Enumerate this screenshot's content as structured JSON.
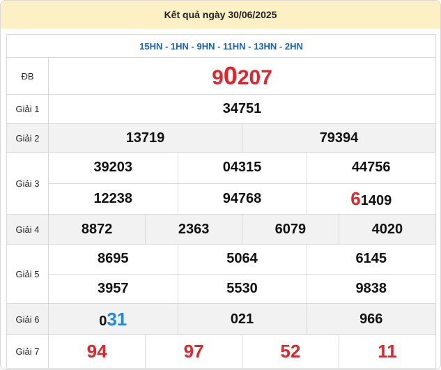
{
  "header": {
    "title": "Kết quả ngày 30/06/2025"
  },
  "codes": "15HN - 1HN - 9HN - 11HN - 13HN - 2HN",
  "db": {
    "label": "ĐB",
    "prefix": "9",
    "highlight": "0",
    "rest": "207"
  },
  "g1": {
    "label": "Giải 1",
    "values": [
      "34751"
    ]
  },
  "g2": {
    "label": "Giải 2",
    "values": [
      "13719",
      "79394"
    ]
  },
  "g3": {
    "label": "Giải 3",
    "values": [
      "39203",
      "04315",
      "44756",
      "12238",
      "94768"
    ],
    "last": {
      "highlight": "6",
      "rest": "1409"
    }
  },
  "g4": {
    "label": "Giải 4",
    "values": [
      "8872",
      "2363",
      "6079",
      "4020"
    ]
  },
  "g5": {
    "label": "Giải 5",
    "values": [
      "8695",
      "5064",
      "6145",
      "3957",
      "5530",
      "9838"
    ]
  },
  "g6": {
    "label": "Giải 6",
    "first": {
      "prefix": "0",
      "highlight": "31"
    },
    "values": [
      "021",
      "966"
    ]
  },
  "g7": {
    "label": "Giải 7",
    "values": [
      "94",
      "97",
      "52",
      "11"
    ]
  },
  "colors": {
    "red": "#e0262d",
    "blue": "#1e88e5",
    "codes": "#1565c0",
    "header_bg": "#fdf0c4",
    "row_gray": "#f2f2f2"
  }
}
